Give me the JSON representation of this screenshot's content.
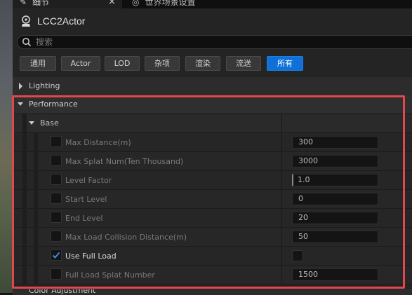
{
  "tabs": [
    {
      "label": "细节",
      "icon": "wrench-icon",
      "active": true
    },
    {
      "label": "世界场景设置",
      "icon": "globe-icon",
      "active": false
    }
  ],
  "actor": {
    "title": "LCC2Actor",
    "icon": "actor-icon"
  },
  "search": {
    "placeholder": "搜索",
    "value": ""
  },
  "filters": [
    {
      "label": "通用",
      "active": false
    },
    {
      "label": "Actor",
      "active": false
    },
    {
      "label": "LOD",
      "active": false
    },
    {
      "label": "杂项",
      "active": false
    },
    {
      "label": "渲染",
      "active": false
    },
    {
      "label": "流送",
      "active": false
    },
    {
      "label": "所有",
      "active": true
    }
  ],
  "categories": {
    "lighting": {
      "label": "Lighting",
      "expanded": false
    },
    "performance": {
      "label": "Performance",
      "expanded": true
    },
    "base": {
      "label": "Base",
      "expanded": true
    },
    "next": {
      "label": "Color Adjustment"
    }
  },
  "properties": [
    {
      "label": "Max Distance(m)",
      "checked": false,
      "value": "300"
    },
    {
      "label": "Max Splat Num(Ten Thousand)",
      "checked": false,
      "value": "3000"
    },
    {
      "label": "Level Factor",
      "checked": false,
      "value": "1.0"
    },
    {
      "label": "Start Level",
      "checked": false,
      "value": "0"
    },
    {
      "label": "End Level",
      "checked": false,
      "value": "20"
    },
    {
      "label": "Max Load Collision Distance(m)",
      "checked": false,
      "value": "50"
    },
    {
      "label": "Use Full Load",
      "checked": true,
      "value_checked": false
    },
    {
      "label": "Full Load Splat Number",
      "checked": false,
      "value": "1500"
    }
  ],
  "colors": {
    "accent": "#0f70d7",
    "highlight": "#e0484d",
    "check": "#3a8ee6"
  }
}
